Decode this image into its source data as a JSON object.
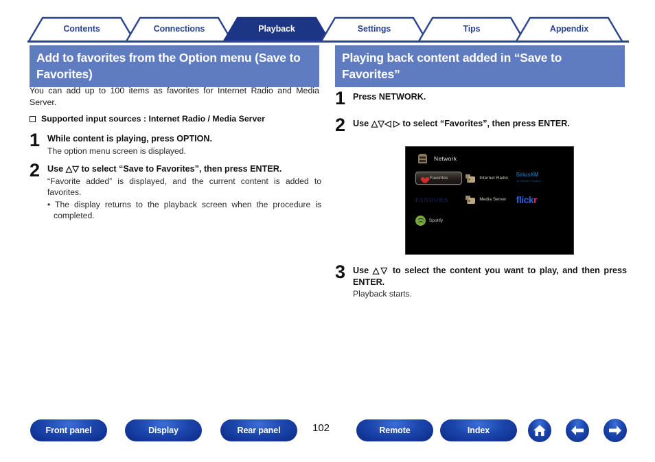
{
  "tabs": [
    {
      "label": "Contents",
      "active": false
    },
    {
      "label": "Connections",
      "active": false
    },
    {
      "label": "Playback",
      "active": true
    },
    {
      "label": "Settings",
      "active": false
    },
    {
      "label": "Tips",
      "active": false
    },
    {
      "label": "Appendix",
      "active": false
    }
  ],
  "left": {
    "heading": "Add to favorites from the Option menu (Save to Favorites)",
    "intro": "You can add up to 100 items as favorites for Internet Radio and Media Server.",
    "supported_label": "Supported input sources : Internet Radio / Media Server",
    "steps": [
      {
        "num": "1",
        "title": "While content is playing, press OPTION.",
        "desc": "The option menu screen is displayed.",
        "sub": ""
      },
      {
        "num": "2",
        "title": "Use △▽ to select “Save to Favorites”, then press ENTER.",
        "desc": "“Favorite added” is displayed, and the current content is added to favorites.",
        "sub": "• The display returns to the playback screen when the procedure is completed."
      }
    ]
  },
  "right": {
    "heading": "Playing back content added in “Save to Favorites”",
    "steps": [
      {
        "num": "1",
        "title": "Press NETWORK.",
        "desc": "",
        "sub": ""
      },
      {
        "num": "2",
        "title": "Use △▽◁ ▷ to select “Favorites”, then press ENTER.",
        "desc": "",
        "sub": ""
      },
      {
        "num": "3",
        "title": "Use △▽ to select the content you want to play, and then press ENTER.",
        "desc": "Playback starts.",
        "sub": ""
      }
    ]
  },
  "osd": {
    "title": "Network",
    "items": [
      {
        "label": "Favorites",
        "icon": "heart-icon",
        "selected": true
      },
      {
        "label": "Internet Radio",
        "icon": "folder-icon",
        "selected": false
      },
      {
        "label": "SiriusXM",
        "icon": "siriusxm-logo",
        "sublabel": "INTERNET RADIO",
        "selected": false
      },
      {
        "label": "PANDORA",
        "icon": "pandora-logo",
        "selected": false
      },
      {
        "label": "Media Server",
        "icon": "folder-icon",
        "selected": false
      },
      {
        "label": "flickr",
        "icon": "flickr-logo",
        "selected": false
      },
      {
        "label": "Spotify",
        "icon": "spotify-icon",
        "selected": false
      }
    ]
  },
  "footer": {
    "buttons": [
      {
        "label": "Front panel"
      },
      {
        "label": "Display"
      },
      {
        "label": "Rear panel"
      },
      {
        "label": "Remote"
      },
      {
        "label": "Index"
      }
    ],
    "page_number": "102",
    "icons": [
      {
        "name": "home-icon"
      },
      {
        "name": "back-arrow-icon"
      },
      {
        "name": "forward-arrow-icon"
      }
    ]
  },
  "colors": {
    "tab_active_bg": "#1c3585",
    "tab_text": "#2b4491",
    "section_heading_bg": "#5f7cc0",
    "pill_blue": "#1c46ad"
  }
}
